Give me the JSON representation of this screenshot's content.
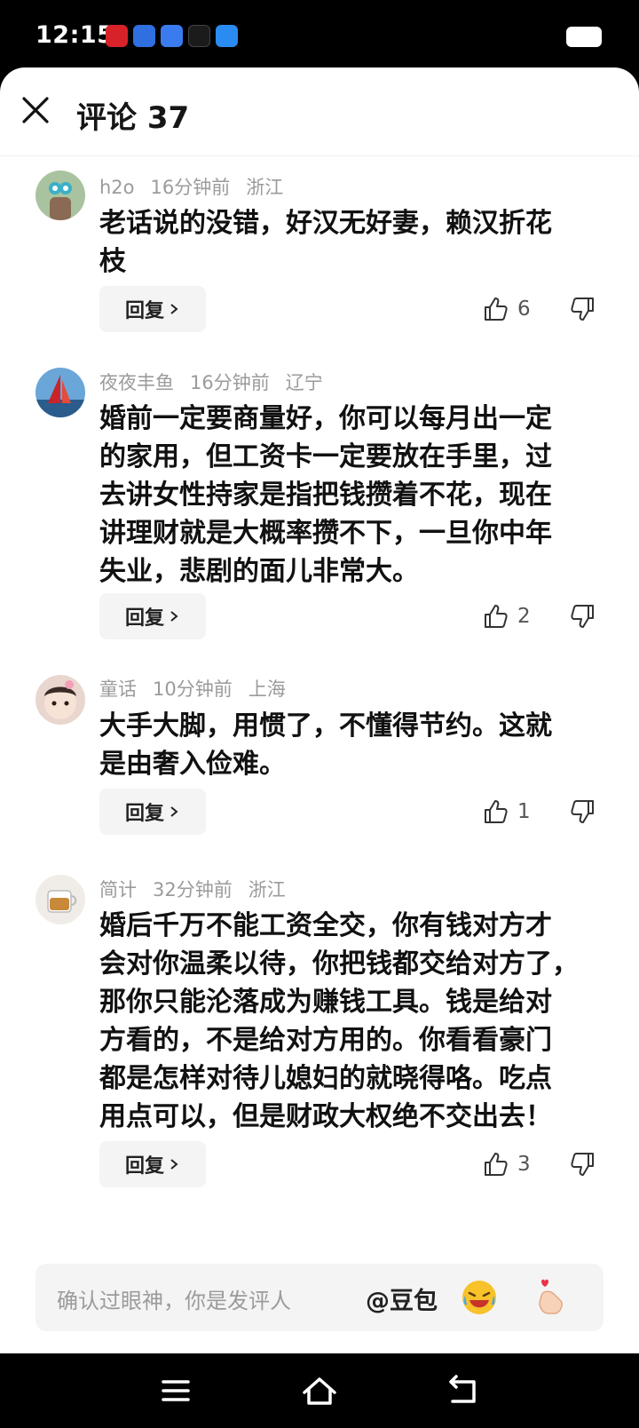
{
  "status_bar": {
    "time": "12:15",
    "app_icons": [
      "xiaohongshu-icon",
      "docs-icon",
      "baidu-icon",
      "douyin-icon",
      "browser-icon"
    ]
  },
  "header": {
    "title": "评论 37"
  },
  "comments": [
    {
      "user": "h2o",
      "time": "16分钟前",
      "location": "浙江",
      "lines": [
        "老话说的没错，好汉无好妻，赖汉折花",
        "枝"
      ],
      "reply_label": "回复",
      "likes": "6"
    },
    {
      "user": "夜夜丰鱼",
      "time": "16分钟前",
      "location": "辽宁",
      "lines": [
        "婚前一定要商量好，你可以每月出一定",
        "的家用，但工资卡一定要放在手里，过",
        "去讲女性持家是指把钱攒着不花，现在",
        "讲理财就是大概率攒不下，一旦你中年",
        "失业，悲剧的面儿非常大。"
      ],
      "reply_label": "回复",
      "likes": "2"
    },
    {
      "user": "童话",
      "time": "10分钟前",
      "location": "上海",
      "lines": [
        "大手大脚，用惯了，不懂得节约。这就",
        "是由奢入俭难。"
      ],
      "reply_label": "回复",
      "likes": "1"
    },
    {
      "user": "简计",
      "time": "32分钟前",
      "location": "浙江",
      "lines": [
        "婚后千万不能工资全交，你有钱对方才",
        "会对你温柔以待，你把钱都交给对方了，",
        "那你只能沦落成为赚钱工具。钱是给对",
        "方看的，不是给对方用的。你看看豪门",
        "都是怎样对待儿媳妇的就晓得咯。吃点",
        "用点可以，但是财政大权绝不交出去！"
      ],
      "reply_label": "回复",
      "likes": "3"
    }
  ],
  "input_bar": {
    "placeholder": "确认过眼神，你是发评人",
    "mention": "@豆包"
  },
  "colors": {
    "text_primary": "#111111",
    "meta": "#9b9b9b",
    "reply_bg": "#f4f4f4",
    "status_bar": "#000000"
  }
}
